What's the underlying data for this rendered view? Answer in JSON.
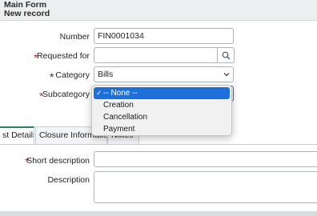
{
  "header": {
    "title": "Main Form",
    "subtitle": "New record"
  },
  "fields": {
    "number": {
      "label": "Number",
      "value": "FIN0001034"
    },
    "requested_for": {
      "label": "Requested for",
      "value": ""
    },
    "category": {
      "label": "Category",
      "value": "Bills"
    },
    "subcategory": {
      "label": "Subcategory",
      "options": [
        "-- None --",
        "Creation",
        "Cancellation",
        "Payment"
      ],
      "selected": "-- None --"
    },
    "short_description": {
      "label": "Short description",
      "value": ""
    },
    "description": {
      "label": "Description",
      "value": ""
    }
  },
  "tabs": [
    {
      "label": "st Details",
      "active": true
    },
    {
      "label": "Closure Information",
      "active": false
    },
    {
      "label": "Notes",
      "active": false
    }
  ],
  "required_marker": "*",
  "check_mark": "✓",
  "colors": {
    "required": "#d9272e",
    "active_tab": "#2f7d61",
    "selected_option": "#1d6fdc"
  }
}
